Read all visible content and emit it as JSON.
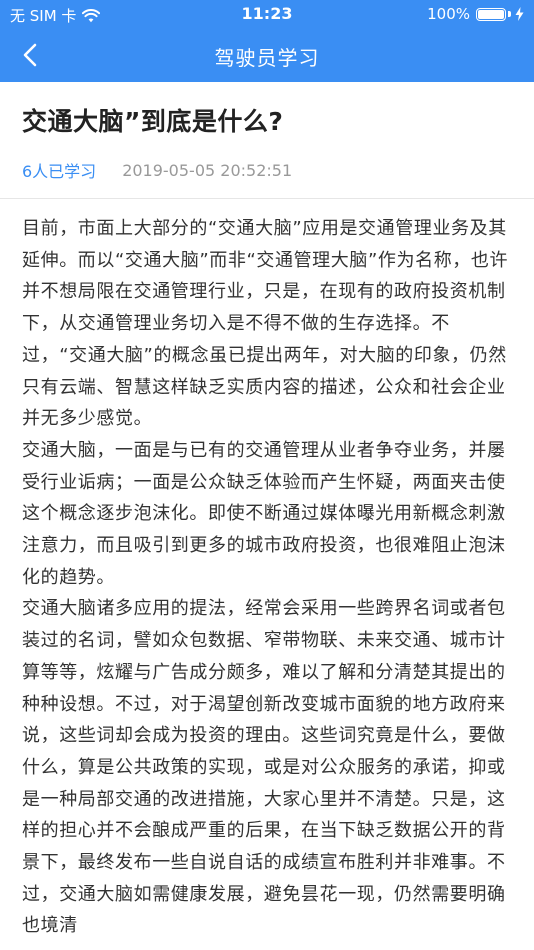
{
  "status_bar": {
    "carrier": "无 SIM 卡",
    "wifi_icon": "wifi-icon",
    "time": "11:23",
    "battery": "100%",
    "battery_level_percent": 100
  },
  "nav": {
    "back_icon": "chevron-left-icon",
    "title": "驾驶员学习"
  },
  "article": {
    "title": "交通大脑”到底是什么?",
    "learner_count": "6人已学习",
    "datetime": "2019-05-05 20:52:51",
    "paragraphs": [
      "目前，市面上大部分的“交通大脑”应用是交通管理业务及其延伸。而以“交通大脑”而非“交通管理大脑”作为名称，也许并不想局限在交通管理行业，只是，在现有的政府投资机制下，从交通管理业务切入是不得不做的生存选择。不过，“交通大脑”的概念虽已提出两年，对大脑的印象，仍然只有云端、智慧这样缺乏实质内容的描述，公众和社会企业并无多少感觉。",
      "交通大脑，一面是与已有的交通管理从业者争夺业务，并屡受行业诟病；一面是公众缺乏体验而产生怀疑，两面夹击使这个概念逐步泡沫化。即使不断通过媒体曝光用新概念刺激注意力，而且吸引到更多的城市政府投资，也很难阻止泡沫化的趋势。",
      "交通大脑诸多应用的提法，经常会采用一些跨界名词或者包装过的名词，譬如众包数据、窄带物联、未来交通、城市计算等等，炫耀与广告成分颇多，难以了解和分清楚其提出的种种设想。不过，对于渴望创新改变城市面貌的地方政府来说，这些词却会成为投资的理由。这些词究竟是什么，要做什么，算是公共政策的实现，或是对公众服务的承诺，抑或是一种局部交通的改进措施，大家心里并不清楚。只是，这样的担心并不会酿成严重的后果，在当下缺乏数据公开的背景下，最终发布一些自说自话的成绩宣布胜利并非难事。不过，交通大脑如需健康发展，避免昙花一现，仍然需要明确也境清"
    ]
  },
  "colors": {
    "accent": "#3a8ef3",
    "title_text": "#222222",
    "body_text": "#333333",
    "meta_date": "#999999"
  }
}
